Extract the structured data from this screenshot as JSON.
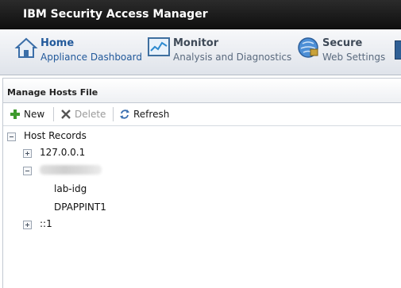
{
  "app": {
    "title": "IBM Security Access Manager"
  },
  "nav": [
    {
      "title": "Home",
      "subtitle": "Appliance Dashboard"
    },
    {
      "title": "Monitor",
      "subtitle": "Analysis and Diagnostics"
    },
    {
      "title": "Secure",
      "subtitle": "Web Settings"
    }
  ],
  "panel": {
    "title": "Manage Hosts File"
  },
  "toolbar": {
    "new_label": "New",
    "delete_label": "Delete",
    "refresh_label": "Refresh"
  },
  "tree": {
    "root_label": "Host Records",
    "records": [
      {
        "address": "127.0.0.1",
        "expanded": false,
        "hostnames": []
      },
      {
        "address": "",
        "expanded": true,
        "hostnames": [
          "lab-idg",
          "DPAPPINT1"
        ]
      },
      {
        "address": "::1",
        "expanded": false,
        "hostnames": []
      }
    ]
  },
  "colors": {
    "titlebar": "#1a1a1a",
    "accent": "#235a9b",
    "add_icon": "#3d9a2d"
  },
  "icons": [
    "home-icon",
    "monitor-icon",
    "secure-icon",
    "plus-icon",
    "delete-icon",
    "refresh-icon"
  ]
}
